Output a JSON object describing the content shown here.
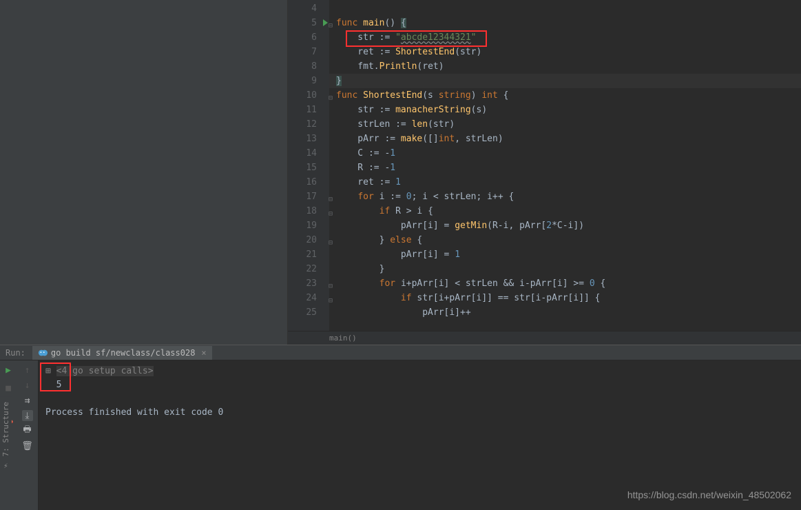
{
  "editor": {
    "breadcrumb": "main()",
    "lines": [
      {
        "n": 4,
        "tokens": []
      },
      {
        "n": 5,
        "runMarker": true,
        "fold": "−",
        "tokens": [
          {
            "t": "func ",
            "c": "kw"
          },
          {
            "t": "main",
            "c": "fn"
          },
          {
            "t": "() ",
            "c": "punct"
          },
          {
            "t": "{",
            "c": "paren-hl"
          }
        ]
      },
      {
        "n": 6,
        "tokens": [
          {
            "t": "    str := ",
            "c": "ident"
          },
          {
            "t": "\"",
            "c": "str-lit"
          },
          {
            "t": "abcde12344321",
            "c": "str-lit str-underline"
          },
          {
            "t": "\"",
            "c": "str-lit"
          }
        ]
      },
      {
        "n": 7,
        "tokens": [
          {
            "t": "    ret := ",
            "c": "ident"
          },
          {
            "t": "ShortestEnd",
            "c": "fn"
          },
          {
            "t": "(str)",
            "c": "ident"
          }
        ]
      },
      {
        "n": 8,
        "tokens": [
          {
            "t": "    fmt.",
            "c": "ident"
          },
          {
            "t": "Println",
            "c": "fn"
          },
          {
            "t": "(ret)",
            "c": "ident"
          }
        ]
      },
      {
        "n": 9,
        "current": true,
        "fold": "⌊",
        "tokens": [
          {
            "t": "}",
            "c": "paren-hl"
          }
        ]
      },
      {
        "n": 10,
        "fold": "−",
        "tokens": [
          {
            "t": "func ",
            "c": "kw"
          },
          {
            "t": "ShortestEnd",
            "c": "fn"
          },
          {
            "t": "(s ",
            "c": "ident"
          },
          {
            "t": "string",
            "c": "type"
          },
          {
            "t": ") ",
            "c": "ident"
          },
          {
            "t": "int ",
            "c": "type"
          },
          {
            "t": "{",
            "c": "punct"
          }
        ]
      },
      {
        "n": 11,
        "tokens": [
          {
            "t": "    str := ",
            "c": "ident"
          },
          {
            "t": "manacherString",
            "c": "fn"
          },
          {
            "t": "(s)",
            "c": "ident"
          }
        ]
      },
      {
        "n": 12,
        "tokens": [
          {
            "t": "    strLen := ",
            "c": "ident"
          },
          {
            "t": "len",
            "c": "fn"
          },
          {
            "t": "(str)",
            "c": "ident"
          }
        ]
      },
      {
        "n": 13,
        "tokens": [
          {
            "t": "    pArr := ",
            "c": "ident"
          },
          {
            "t": "make",
            "c": "fn"
          },
          {
            "t": "([]",
            "c": "ident"
          },
          {
            "t": "int",
            "c": "type"
          },
          {
            "t": ", strLen)",
            "c": "ident"
          }
        ]
      },
      {
        "n": 14,
        "tokens": [
          {
            "t": "    C := ",
            "c": "ident"
          },
          {
            "t": "-",
            "c": "ident"
          },
          {
            "t": "1",
            "c": "num"
          }
        ]
      },
      {
        "n": 15,
        "tokens": [
          {
            "t": "    R := ",
            "c": "ident"
          },
          {
            "t": "-",
            "c": "ident"
          },
          {
            "t": "1",
            "c": "num"
          }
        ]
      },
      {
        "n": 16,
        "tokens": [
          {
            "t": "    ret := ",
            "c": "ident"
          },
          {
            "t": "1",
            "c": "num"
          }
        ]
      },
      {
        "n": 17,
        "fold": "−",
        "tokens": [
          {
            "t": "    ",
            "c": "ident"
          },
          {
            "t": "for ",
            "c": "kw"
          },
          {
            "t": "i := ",
            "c": "ident"
          },
          {
            "t": "0",
            "c": "num"
          },
          {
            "t": "; i < strLen; i++ {",
            "c": "ident"
          }
        ]
      },
      {
        "n": 18,
        "fold": "−",
        "tokens": [
          {
            "t": "        ",
            "c": "ident"
          },
          {
            "t": "if ",
            "c": "kw"
          },
          {
            "t": "R > i {",
            "c": "ident"
          }
        ]
      },
      {
        "n": 19,
        "tokens": [
          {
            "t": "            pArr[i] = ",
            "c": "ident"
          },
          {
            "t": "getMin",
            "c": "fn"
          },
          {
            "t": "(R-i, pArr[",
            "c": "ident"
          },
          {
            "t": "2",
            "c": "num"
          },
          {
            "t": "*C-i])",
            "c": "ident"
          }
        ]
      },
      {
        "n": 20,
        "fold": "−",
        "tokens": [
          {
            "t": "        } ",
            "c": "ident"
          },
          {
            "t": "else ",
            "c": "kw"
          },
          {
            "t": "{",
            "c": "ident"
          }
        ]
      },
      {
        "n": 21,
        "tokens": [
          {
            "t": "            pArr[i] = ",
            "c": "ident"
          },
          {
            "t": "1",
            "c": "num"
          }
        ]
      },
      {
        "n": 22,
        "fold": "⌊",
        "tokens": [
          {
            "t": "        }",
            "c": "ident"
          }
        ]
      },
      {
        "n": 23,
        "fold": "−",
        "tokens": [
          {
            "t": "        ",
            "c": "ident"
          },
          {
            "t": "for ",
            "c": "kw"
          },
          {
            "t": "i+pArr[i] < strLen && i-pArr[i] >= ",
            "c": "ident"
          },
          {
            "t": "0 ",
            "c": "num"
          },
          {
            "t": "{",
            "c": "ident"
          }
        ]
      },
      {
        "n": 24,
        "fold": "−",
        "tokens": [
          {
            "t": "            ",
            "c": "ident"
          },
          {
            "t": "if ",
            "c": "kw"
          },
          {
            "t": "str[i+pArr[i]] == str[i-pArr[i]] {",
            "c": "ident"
          }
        ]
      },
      {
        "n": 25,
        "tokens": [
          {
            "t": "                pArr[i]++",
            "c": "ident"
          }
        ]
      }
    ]
  },
  "run": {
    "label": "Run:",
    "tab": "go build sf/newclass/class028",
    "setup_line": "<4 go setup calls>",
    "output_value": "5",
    "finished_line": "Process finished with exit code 0"
  },
  "sidebar_tab": "⚡ 7: Structure",
  "watermark": "https://blog.csdn.net/weixin_48502062"
}
